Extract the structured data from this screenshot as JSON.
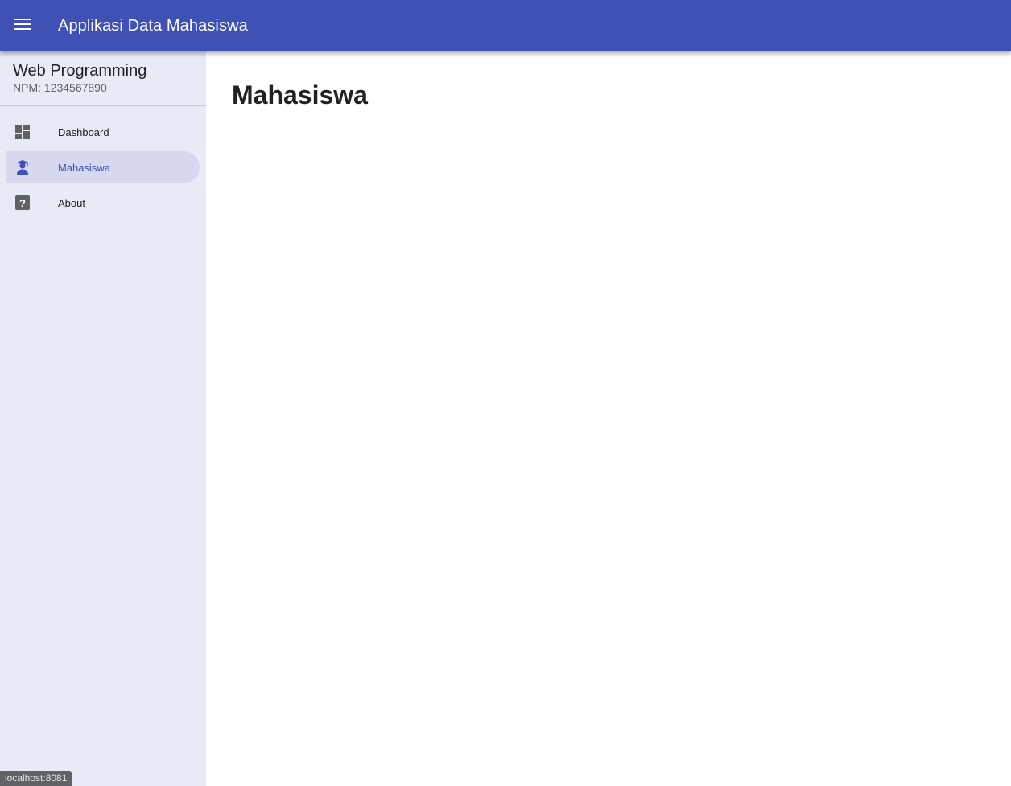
{
  "app_bar": {
    "title": "Applikasi Data Mahasiswa",
    "menu_icon": "hamburger-menu-icon",
    "color": "#3f51b5"
  },
  "drawer": {
    "title": "Web Programming",
    "subtitle": "NPM: 1234567890",
    "background": "#e8eaf6",
    "items": [
      {
        "label": "Dashboard",
        "icon": "dashboard-icon",
        "active": false
      },
      {
        "label": "Mahasiswa",
        "icon": "student-icon",
        "active": true
      },
      {
        "label": "About",
        "icon": "help-icon",
        "active": false
      }
    ]
  },
  "main": {
    "title": "Mahasiswa"
  },
  "status_bar": {
    "url": "localhost:8081"
  }
}
